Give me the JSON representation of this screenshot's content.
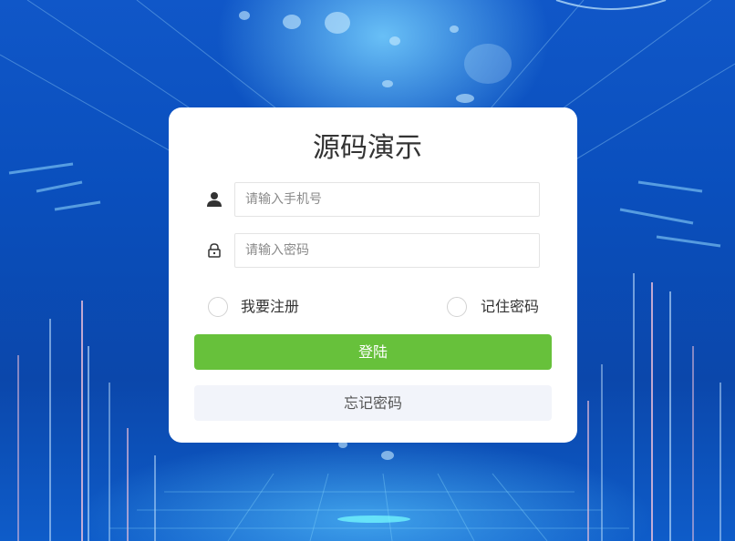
{
  "login": {
    "title": "源码演示",
    "phone_placeholder": "请输入手机号",
    "password_placeholder": "请输入密码",
    "register_label": "我要注册",
    "remember_label": "记住密码",
    "login_button": "登陆",
    "forgot_button": "忘记密码"
  },
  "icons": {
    "phone": "user-icon",
    "password": "lock-icon"
  },
  "colors": {
    "login_button": "#67c13b",
    "forgot_button": "#f2f4fa",
    "card": "#ffffff"
  }
}
